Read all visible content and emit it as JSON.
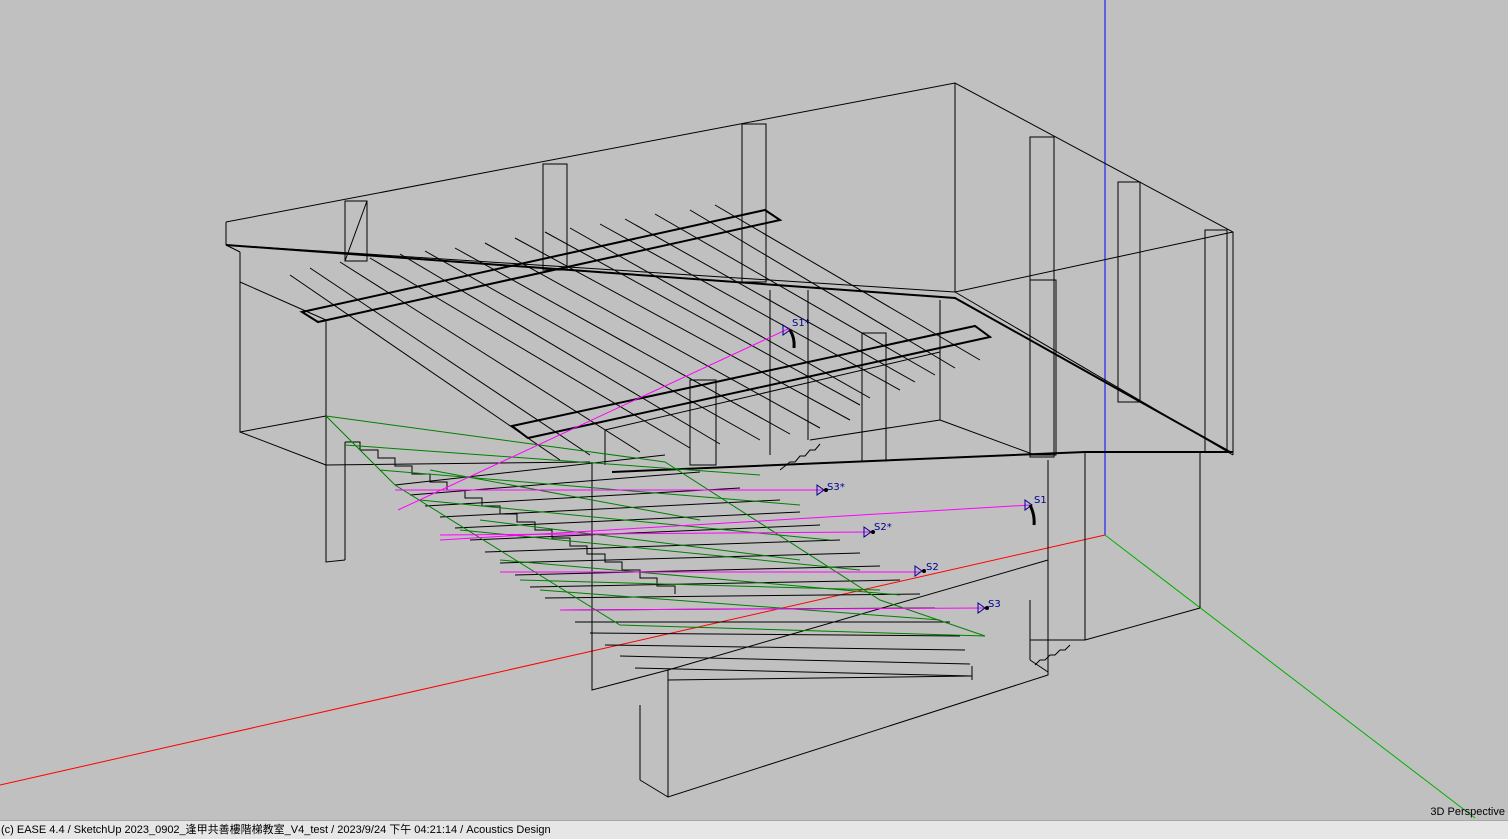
{
  "status_bar": {
    "text": "(c) EASE 4.4  / SketchUp 2023_0902_逢甲共善樓階梯教室_V4_test  / 2023/9/24 下午 04:21:14 / Acoustics Design"
  },
  "viewport": {
    "view_mode": "3D Perspective"
  },
  "sources": [
    {
      "label": "S1"
    },
    {
      "label": "S1*"
    },
    {
      "label": "S2"
    },
    {
      "label": "S2*"
    },
    {
      "label": "S3"
    },
    {
      "label": "S3*"
    }
  ],
  "colors": {
    "background": "#c0c0c0",
    "wireframe": "#000000",
    "x_axis": "#ff0000",
    "y_axis": "#00b000",
    "z_axis": "#0000ff",
    "audience_area": "#008000",
    "source_aim": "#ff00ff",
    "source_label": "#000090"
  }
}
